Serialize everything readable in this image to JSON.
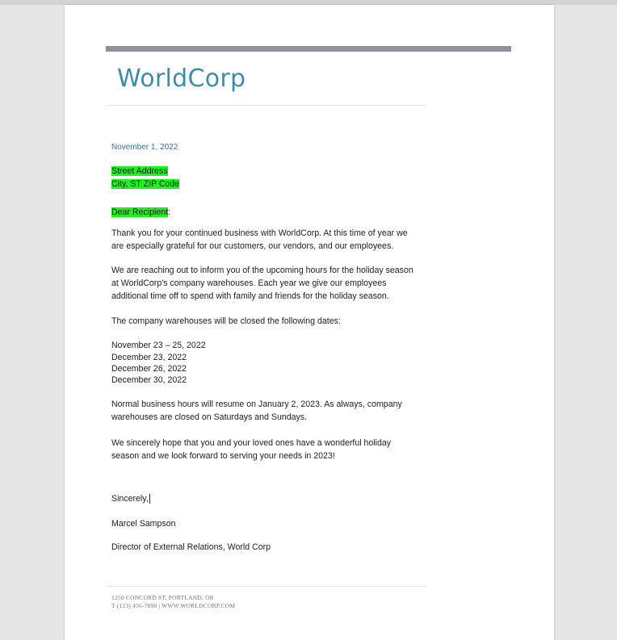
{
  "header": {
    "logo_text": "WorldCorp"
  },
  "letter": {
    "date": "November 1, 2022",
    "address_line1": "Street Address",
    "address_line2": "City, ST ZIP Code",
    "salutation": "Dear Recipient",
    "salutation_punct": ":",
    "paragraph1": [
      "Thank you for your continued business with WorldCorp.  At this time of year we",
      "are especially grateful for our customers, our vendors, and our employees."
    ],
    "paragraph2": [
      "We are reaching out to inform you of the upcoming hours for the holiday season",
      "at WorldCorp's company warehouses.  Each year we give our employees",
      "additional time off to spend with family and friends for the holiday season."
    ],
    "paragraph3": "The company warehouses will be closed the following dates:",
    "closed_dates": [
      "November 23 – 25, 2022",
      "December 23, 2022",
      "December 26, 2022",
      "December 30, 2022"
    ],
    "paragraph4": [
      "Normal business hours will resume on January 2, 2023.  As always, company",
      "warehouses are closed on Saturdays and Sundays."
    ],
    "paragraph5": [
      "We sincerely hope that you and your loved ones have a wonderful holiday",
      "season and we look forward to serving your needs in 2023!"
    ],
    "closing": "Sincerely,",
    "signer_name": "Marcel Sampson",
    "signer_title": "Director of External Relations, World Corp"
  },
  "footer": {
    "line1": "1250 CONCORD ST, PORTLAND, OR",
    "line2": "T (123) 456-7890 | WWW.WORLDCORP.COM"
  },
  "colors": {
    "highlight": "#1bf51b",
    "header_bar": "#8e9199",
    "logo": "#3f8ca5"
  }
}
